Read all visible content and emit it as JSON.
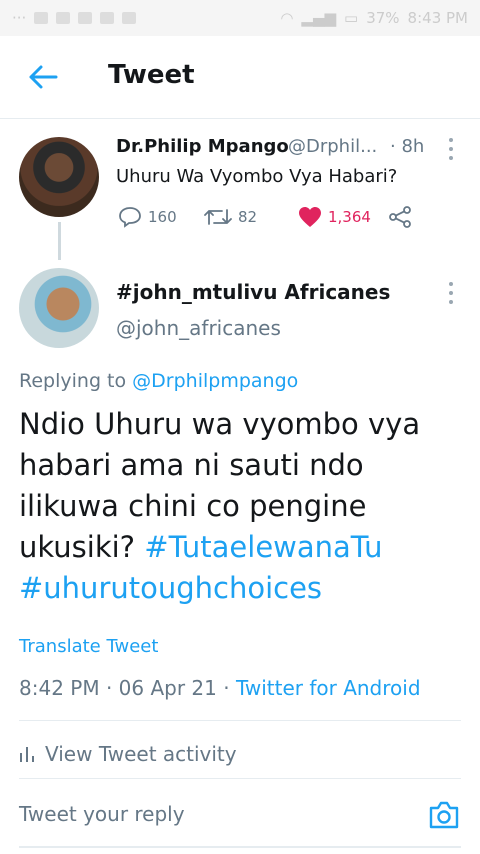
{
  "status_bar": {
    "battery": "37%",
    "time": "8:43 PM"
  },
  "header": {
    "title": "Tweet"
  },
  "original_tweet": {
    "name": "Dr.Philip Mpango",
    "handle": "@Drphil...",
    "time": "· 8h",
    "text": "Uhuru Wa Vyombo Vya Habari?",
    "replies": "160",
    "retweets": "82",
    "likes": "1,364"
  },
  "reply_tweet": {
    "name": "#john_mtulivu Africanes",
    "handle": "@john_africanes",
    "replying_prefix": "Replying to ",
    "replying_to": "@Drphilpmpango",
    "text": "Ndio Uhuru wa vyombo vya habari ama ni sauti ndo ilikuwa chini co pengine ukusiki?",
    "hashtag_1": "#TutaelewanaTu",
    "hashtag_2": "#uhurutoughchoices",
    "translate_label": "Translate Tweet",
    "timestamp": "8:42 PM · 06 Apr 21 · ",
    "source": "Twitter for Android"
  },
  "activity_label": "View Tweet activity",
  "reply_placeholder": "Tweet your reply",
  "colors": {
    "accent": "#1da1f2",
    "like": "#e0245e",
    "muted": "#657786"
  }
}
